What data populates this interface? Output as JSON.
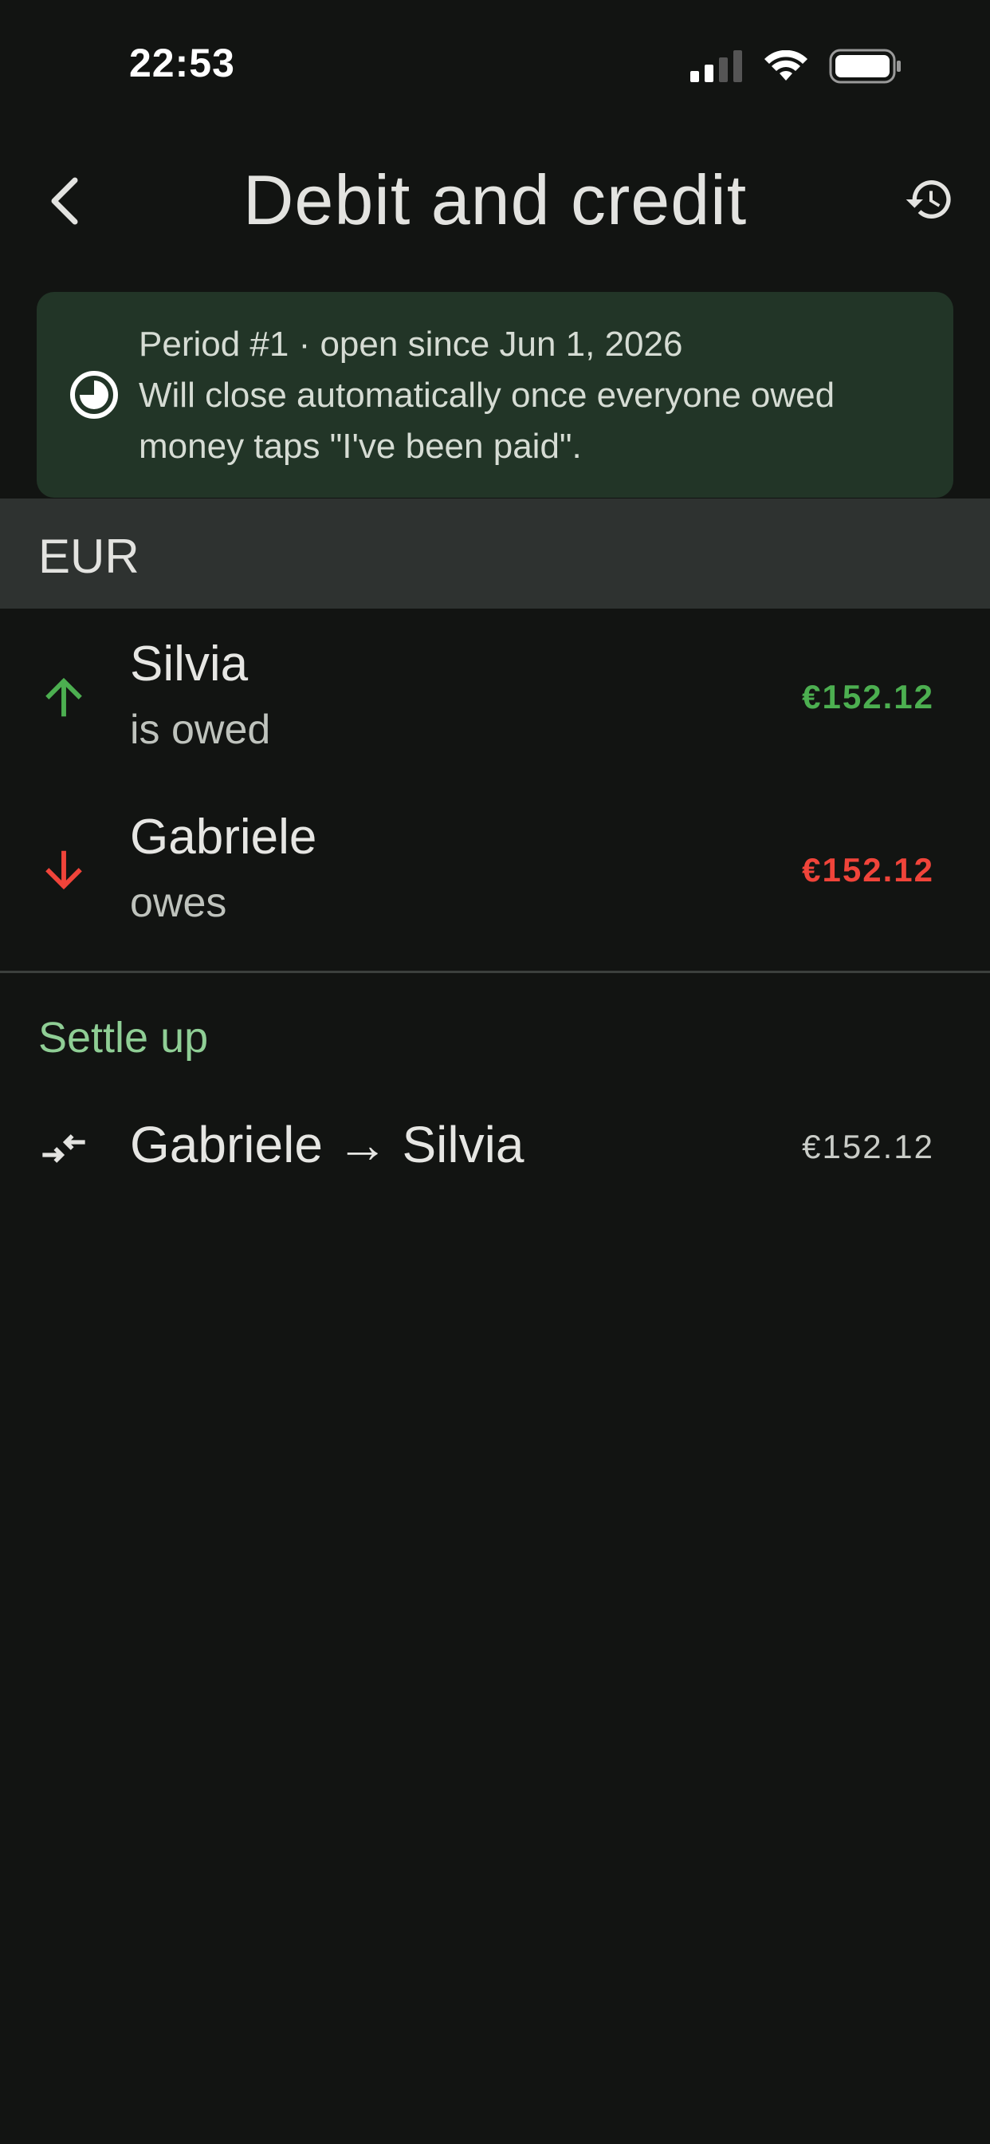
{
  "status_bar": {
    "time": "22:53"
  },
  "header": {
    "title": "Debit and credit"
  },
  "period": {
    "line1": "Period #1 · open since Jun 1, 2026",
    "line2": "Will close automatically once everyone owed",
    "line3": "money taps \"I've been paid\"."
  },
  "currency": "EUR",
  "balances": [
    {
      "name": "Silvia",
      "status": "is owed",
      "amount": "€152.12",
      "direction": "up",
      "color": "#4caf50"
    },
    {
      "name": "Gabriele",
      "status": "owes",
      "amount": "€152.12",
      "direction": "down",
      "color": "#f0443a"
    }
  ],
  "settle": {
    "heading": "Settle up",
    "transfer": "Gabriele → Silvia",
    "amount": "€152.12"
  },
  "colors": {
    "background": "#121412",
    "card": "#223527",
    "currency_bar": "#2e3230",
    "positive": "#4caf50",
    "negative": "#f0443a",
    "accent": "#8fce95"
  }
}
